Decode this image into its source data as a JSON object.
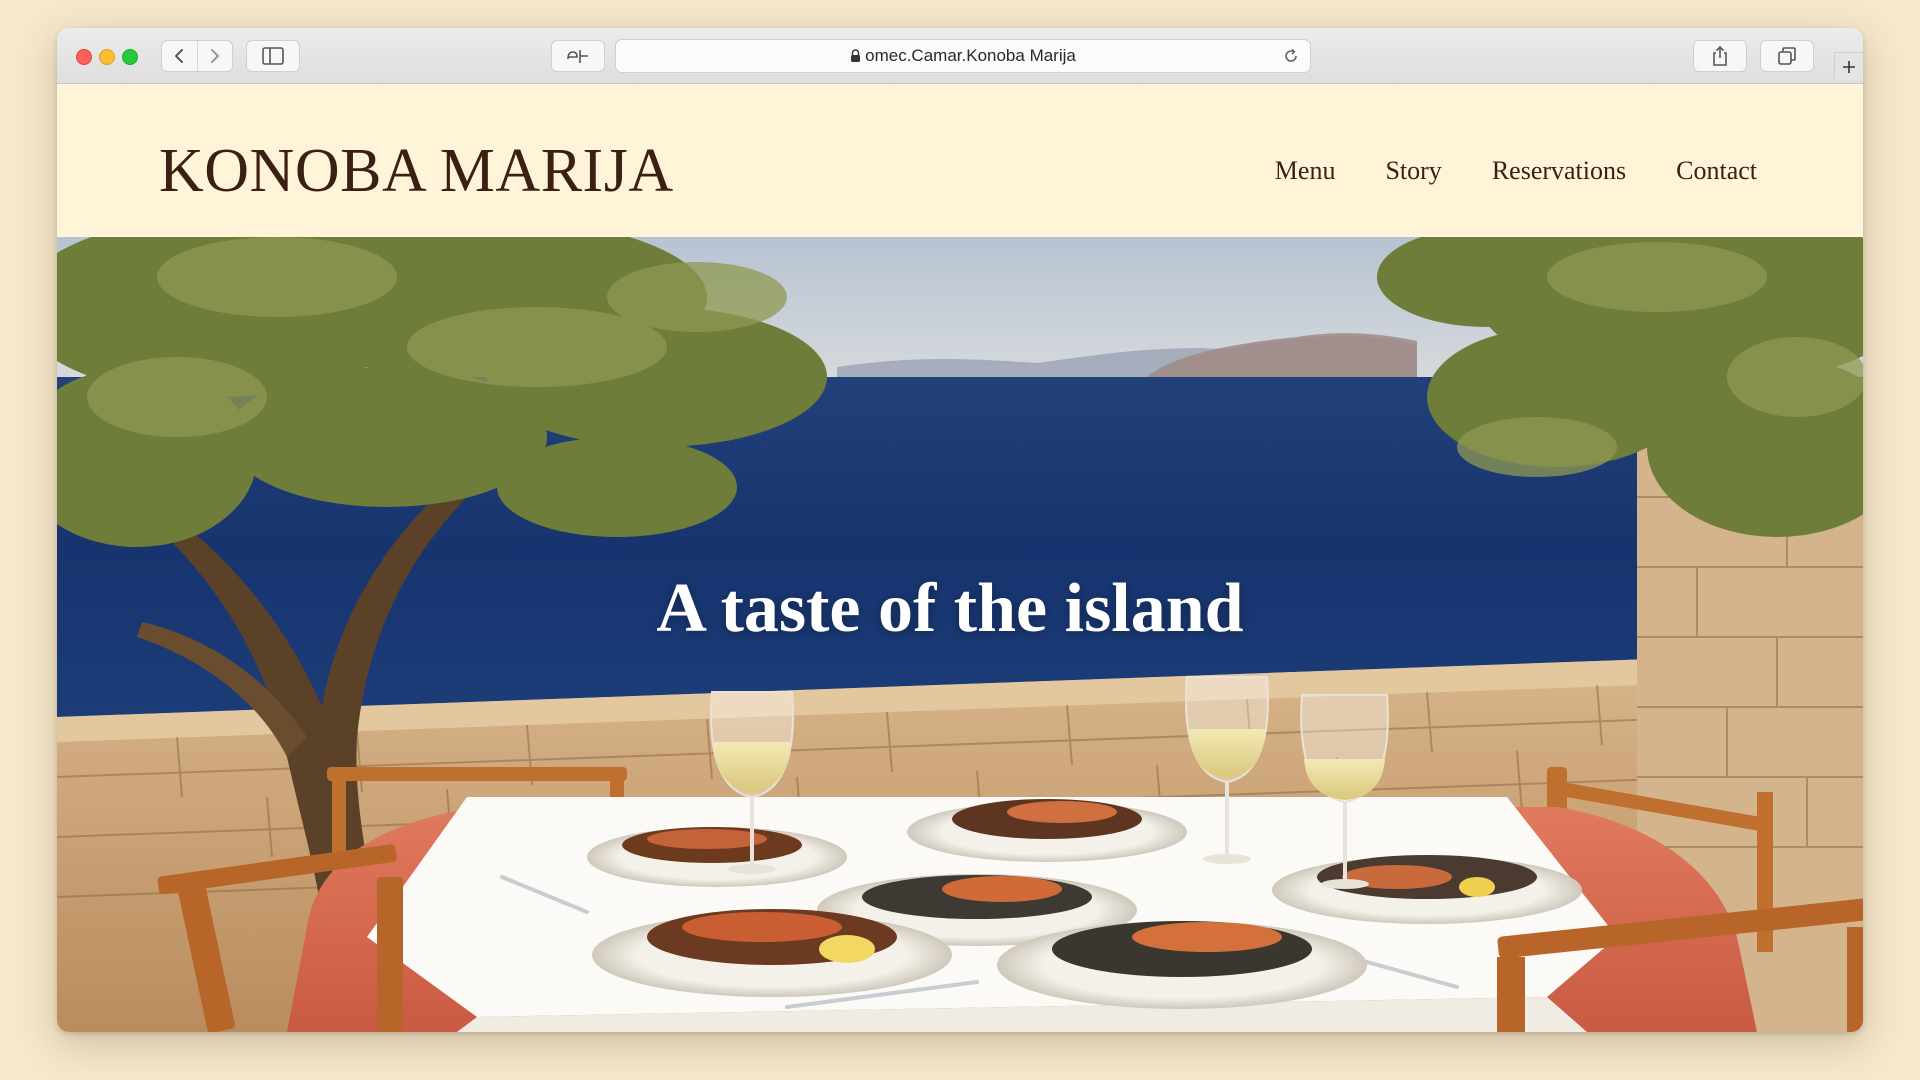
{
  "browser": {
    "url": "omec.Camar.Konoba Marija",
    "icons": {
      "back": "chevron-left-icon",
      "forward": "chevron-right-icon",
      "sidebar": "sidebar-icon",
      "reader": "reader-icon",
      "lock": "lock-icon",
      "reload": "reload-icon",
      "share": "share-icon",
      "tabs": "tabs-icon",
      "new_tab": "plus-icon"
    }
  },
  "site": {
    "logo": "KONOBA MARIJA",
    "nav": [
      "Menu",
      "Story",
      "Reservations",
      "Contact"
    ],
    "hero_title": "A taste of the island"
  },
  "colors": {
    "header_bg": "#fff3d8",
    "text_brown": "#3b1f12",
    "sea": "#17346f",
    "tablecloth": "#d9684e"
  }
}
